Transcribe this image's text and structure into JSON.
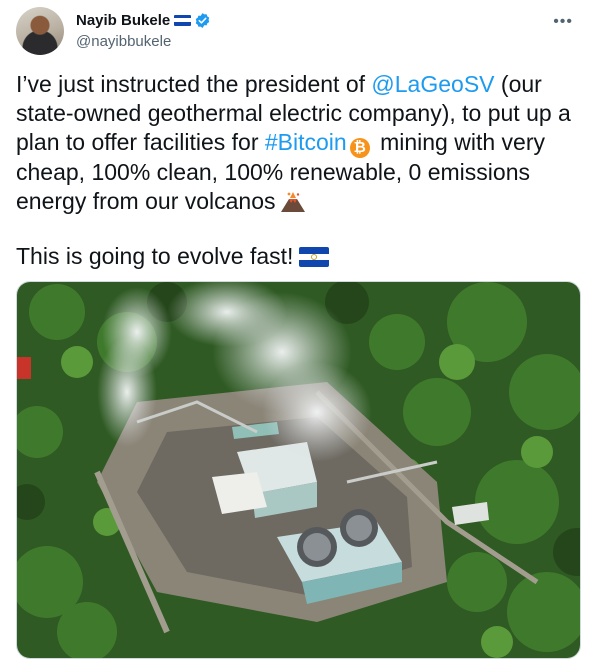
{
  "author": {
    "name": "Nayib Bukele",
    "handle": "@nayibbukele",
    "verified": true
  },
  "icons": {
    "more": "more-options-icon",
    "verified": "verified-badge-icon",
    "flag": "el-salvador-flag-icon",
    "bitcoin": "bitcoin-icon",
    "volcano": "volcano-icon"
  },
  "tweet": {
    "line1_pre": "I’ve just instructed the president of ",
    "mention": "@LaGeoSV",
    "line1_post": " (our",
    "line2": "state-owned geothermal electric company), to put up a",
    "line3_pre": "plan to offer facilities for ",
    "hashtag": "#Bitcoin",
    "line3_post": " mining with very",
    "line4": "cheap, 100% clean, 100% renewable, 0 emissions",
    "line5": "energy from our volcanos",
    "line6": "This is going to evolve fast!"
  },
  "colors": {
    "link": "#1d9bf0",
    "text": "#0f1419",
    "secondary": "#536471",
    "bitcoin": "#f7931a",
    "flag_blue": "#0f47af"
  }
}
